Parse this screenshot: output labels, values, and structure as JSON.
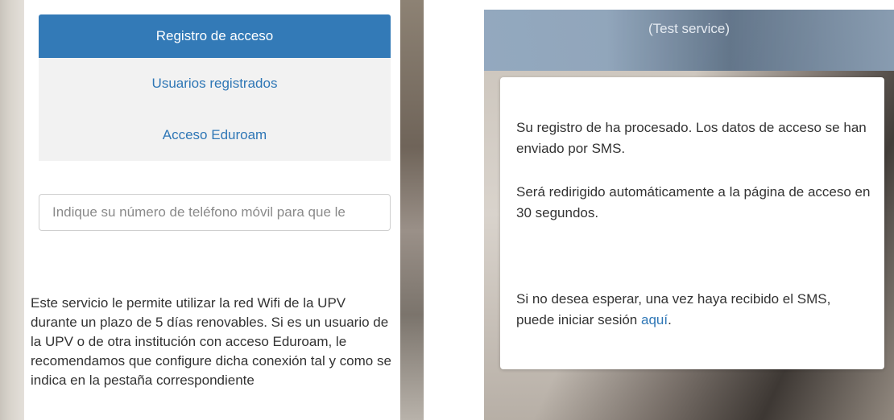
{
  "left": {
    "tabs": [
      {
        "label": "Registro de acceso",
        "active": true
      },
      {
        "label": "Usuarios registrados",
        "active": false
      },
      {
        "label": "Acceso Eduroam",
        "active": false
      }
    ],
    "phone_placeholder": "Indique su número de teléfono móvil para que le",
    "service_description": "Este servicio le permite utilizar la red Wifi de la UPV durante un plazo de 5 días renovables. Si es un usuario de la UPV o de otra institución con acceso Eduroam, le recomendamos que configure dicha conexión tal y como se indica en la pestaña correspondiente"
  },
  "right": {
    "header_title": "(Test service)",
    "message_processed": "Su registro de ha procesado. Los datos de acceso se han enviado por SMS.",
    "message_redirect": "Será redirigido automáticamente a la página de acceso en 30 segundos.",
    "message_wait_prefix": "Si no desea esperar, una vez haya recibido el SMS, puede iniciar sesión ",
    "message_wait_link": "aquí",
    "message_wait_suffix": "."
  },
  "colors": {
    "primary": "#337ab7",
    "link": "#2f77b6",
    "tab_inactive_bg": "#f2f2f2",
    "text": "#333333"
  }
}
